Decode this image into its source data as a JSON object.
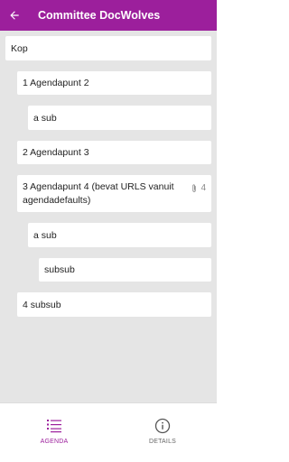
{
  "appbar": {
    "title": "Committee DocWolves",
    "back_icon": "arrow-left-icon",
    "background": "#9c1f9c"
  },
  "agenda": [
    {
      "label": "Kop",
      "depth": 0
    },
    {
      "label": "1 Agendapunt 2",
      "depth": 1
    },
    {
      "label": "a sub",
      "depth": 2
    },
    {
      "label": "2 Agendapunt 3",
      "depth": 1
    },
    {
      "label": "3 Agendapunt 4 (bevat URLS vanuit agendadefaults)",
      "depth": 1,
      "attachments": "4"
    },
    {
      "label": "a sub",
      "depth": 2
    },
    {
      "label": "subsub",
      "depth": 3
    },
    {
      "label": "4 subsub",
      "depth": 1
    }
  ],
  "bottom_nav": {
    "tabs": [
      {
        "label": "AGENDA",
        "icon": "list-icon",
        "active": true
      },
      {
        "label": "DETAILS",
        "icon": "info-icon",
        "active": false
      }
    ],
    "active_color": "#9c1f9c"
  }
}
